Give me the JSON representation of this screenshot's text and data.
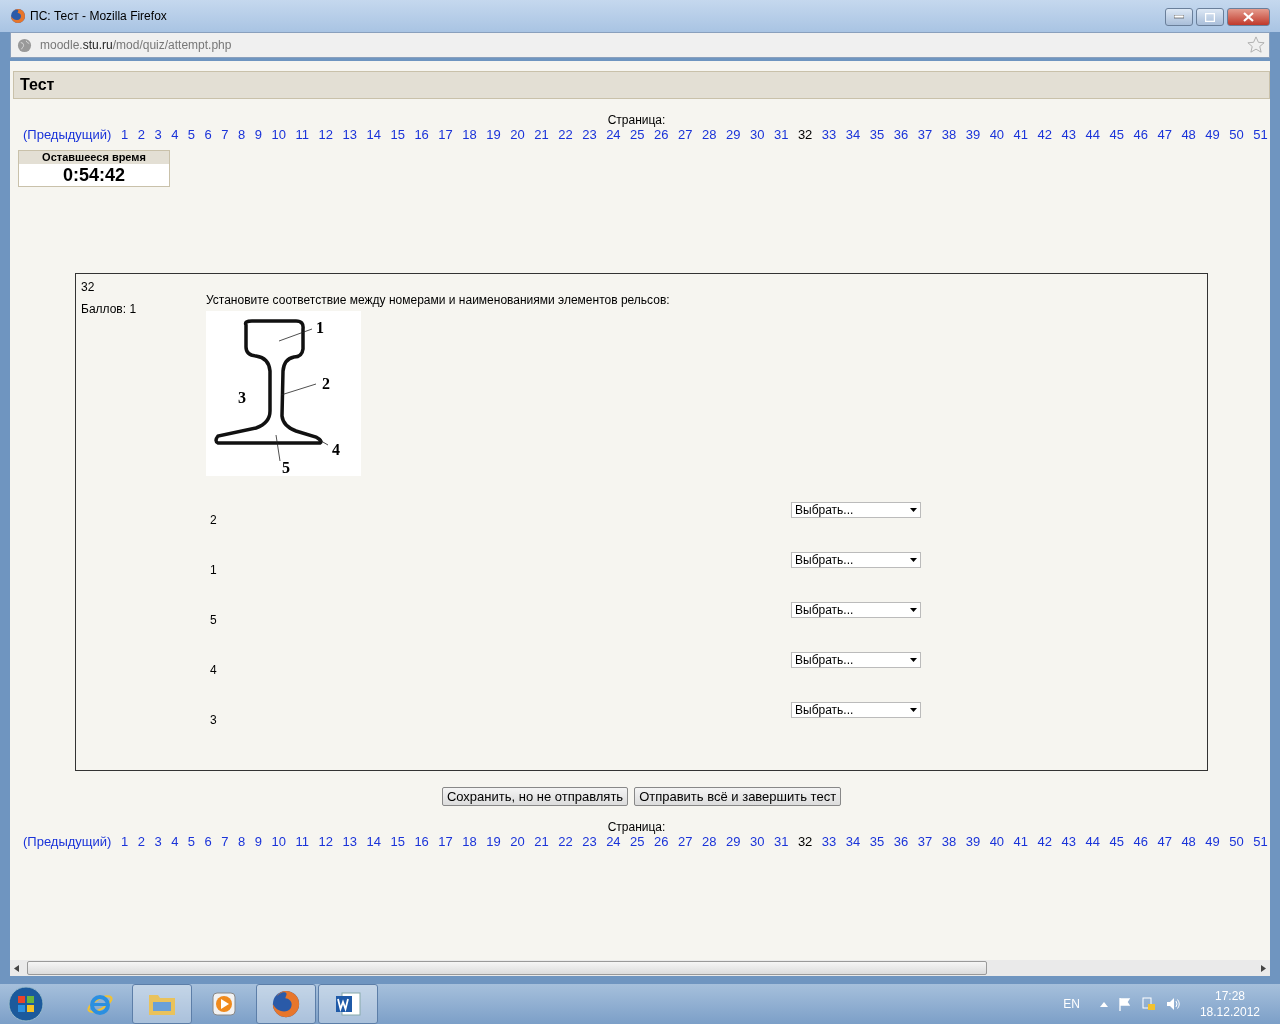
{
  "window": {
    "title": "ПС: Тест - Mozilla Firefox"
  },
  "address_bar": {
    "url_parts": [
      {
        "text": "moodle.",
        "highlight": false
      },
      {
        "text": "stu.ru",
        "highlight": true
      },
      {
        "text": "/mod/quiz/attempt.php",
        "highlight": false
      }
    ]
  },
  "page_heading": "Тест",
  "pagination_top": {
    "label": "Страница:",
    "previous": "(Предыдущий)",
    "pages": [
      {
        "label": "1",
        "selected": false
      },
      {
        "label": "2",
        "selected": false
      },
      {
        "label": "3",
        "selected": false
      },
      {
        "label": "4",
        "selected": false
      },
      {
        "label": "5",
        "selected": false
      },
      {
        "label": "6",
        "selected": false
      },
      {
        "label": "7",
        "selected": false
      },
      {
        "label": "8",
        "selected": false
      },
      {
        "label": "9",
        "selected": false
      },
      {
        "label": "10",
        "selected": false
      },
      {
        "label": "11",
        "selected": false
      },
      {
        "label": "12",
        "selected": false
      },
      {
        "label": "13",
        "selected": false
      },
      {
        "label": "14",
        "selected": false
      },
      {
        "label": "15",
        "selected": false
      },
      {
        "label": "16",
        "selected": false
      },
      {
        "label": "17",
        "selected": false
      },
      {
        "label": "18",
        "selected": false
      },
      {
        "label": "19",
        "selected": false
      },
      {
        "label": "20",
        "selected": false
      },
      {
        "label": "21",
        "selected": false
      },
      {
        "label": "22",
        "selected": false
      },
      {
        "label": "23",
        "selected": false
      },
      {
        "label": "24",
        "selected": false
      },
      {
        "label": "25",
        "selected": false
      },
      {
        "label": "26",
        "selected": false
      },
      {
        "label": "27",
        "selected": false
      },
      {
        "label": "28",
        "selected": false
      },
      {
        "label": "29",
        "selected": false
      },
      {
        "label": "30",
        "selected": false
      },
      {
        "label": "31",
        "selected": false
      },
      {
        "label": "32",
        "selected": true
      },
      {
        "label": "33",
        "selected": false
      },
      {
        "label": "34",
        "selected": false
      },
      {
        "label": "35",
        "selected": false
      },
      {
        "label": "36",
        "selected": false
      },
      {
        "label": "37",
        "selected": false
      },
      {
        "label": "38",
        "selected": false
      },
      {
        "label": "39",
        "selected": false
      },
      {
        "label": "40",
        "selected": false
      },
      {
        "label": "41",
        "selected": false
      },
      {
        "label": "42",
        "selected": false
      },
      {
        "label": "43",
        "selected": false
      },
      {
        "label": "44",
        "selected": false
      },
      {
        "label": "45",
        "selected": false
      },
      {
        "label": "46",
        "selected": false
      },
      {
        "label": "47",
        "selected": false
      },
      {
        "label": "48",
        "selected": false
      },
      {
        "label": "49",
        "selected": false
      },
      {
        "label": "50",
        "selected": false
      },
      {
        "label": "51",
        "selected": false
      }
    ]
  },
  "timer": {
    "label": "Оставшееся время",
    "value": "0:54:42"
  },
  "question": {
    "number": "32",
    "points": "Баллов: 1",
    "text": "Установите соответствие между номерами и наименованиями элементов рельсов:",
    "diagram_labels": [
      "1",
      "2",
      "3",
      "4",
      "5"
    ],
    "rows": [
      {
        "label": "2",
        "choice": "Выбрать..."
      },
      {
        "label": "1",
        "choice": "Выбрать..."
      },
      {
        "label": "5",
        "choice": "Выбрать..."
      },
      {
        "label": "4",
        "choice": "Выбрать..."
      },
      {
        "label": "3",
        "choice": "Выбрать..."
      }
    ]
  },
  "buttons": [
    "Сохранить, но не отправлять",
    "Отправить всё и завершить тест"
  ],
  "pagination_bottom": {
    "label": "Страница:",
    "previous": "(Предыдущий)",
    "pages": [
      {
        "label": "1",
        "selected": false
      },
      {
        "label": "2",
        "selected": false
      },
      {
        "label": "3",
        "selected": false
      },
      {
        "label": "4",
        "selected": false
      },
      {
        "label": "5",
        "selected": false
      },
      {
        "label": "6",
        "selected": false
      },
      {
        "label": "7",
        "selected": false
      },
      {
        "label": "8",
        "selected": false
      },
      {
        "label": "9",
        "selected": false
      },
      {
        "label": "10",
        "selected": false
      },
      {
        "label": "11",
        "selected": false
      },
      {
        "label": "12",
        "selected": false
      },
      {
        "label": "13",
        "selected": false
      },
      {
        "label": "14",
        "selected": false
      },
      {
        "label": "15",
        "selected": false
      },
      {
        "label": "16",
        "selected": false
      },
      {
        "label": "17",
        "selected": false
      },
      {
        "label": "18",
        "selected": false
      },
      {
        "label": "19",
        "selected": false
      },
      {
        "label": "20",
        "selected": false
      },
      {
        "label": "21",
        "selected": false
      },
      {
        "label": "22",
        "selected": false
      },
      {
        "label": "23",
        "selected": false
      },
      {
        "label": "24",
        "selected": false
      },
      {
        "label": "25",
        "selected": false
      },
      {
        "label": "26",
        "selected": false
      },
      {
        "label": "27",
        "selected": false
      },
      {
        "label": "28",
        "selected": false
      },
      {
        "label": "29",
        "selected": false
      },
      {
        "label": "30",
        "selected": false
      },
      {
        "label": "31",
        "selected": false
      },
      {
        "label": "32",
        "selected": true
      },
      {
        "label": "33",
        "selected": false
      },
      {
        "label": "34",
        "selected": false
      },
      {
        "label": "35",
        "selected": false
      },
      {
        "label": "36",
        "selected": false
      },
      {
        "label": "37",
        "selected": false
      },
      {
        "label": "38",
        "selected": false
      },
      {
        "label": "39",
        "selected": false
      },
      {
        "label": "40",
        "selected": false
      },
      {
        "label": "41",
        "selected": false
      },
      {
        "label": "42",
        "selected": false
      },
      {
        "label": "43",
        "selected": false
      },
      {
        "label": "44",
        "selected": false
      },
      {
        "label": "45",
        "selected": false
      },
      {
        "label": "46",
        "selected": false
      },
      {
        "label": "47",
        "selected": false
      },
      {
        "label": "48",
        "selected": false
      },
      {
        "label": "49",
        "selected": false
      },
      {
        "label": "50",
        "selected": false
      },
      {
        "label": "51",
        "selected": false
      }
    ]
  },
  "taskbar": {
    "apps": [
      {
        "kind": "ie",
        "active": false
      },
      {
        "kind": "folder",
        "active": true
      },
      {
        "kind": "media",
        "active": false
      },
      {
        "kind": "firefox",
        "active": true
      },
      {
        "kind": "word",
        "active": true
      }
    ],
    "language": "EN",
    "time": "17:28",
    "date": "18.12.2012"
  }
}
